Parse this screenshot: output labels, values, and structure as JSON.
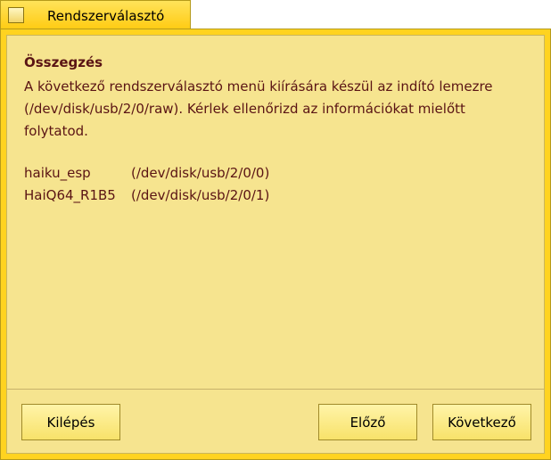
{
  "window": {
    "title": "Rendszerválasztó"
  },
  "summary": {
    "heading": "Összegzés",
    "lines": [
      "A következő rendszerválasztó menü kiírására készül az indító lemezre",
      "(/dev/disk/usb/2/0/raw). Kérlek ellenőrizd az információkat mielőtt",
      "folytatod."
    ],
    "entries": [
      {
        "name": "haiku_esp",
        "path": "(/dev/disk/usb/2/0/0)"
      },
      {
        "name": "HaiQ64_R1B5",
        "path": "(/dev/disk/usb/2/0/1)"
      }
    ]
  },
  "buttons": {
    "quit": "Kilépés",
    "previous": "Előző",
    "next": "Következő"
  }
}
